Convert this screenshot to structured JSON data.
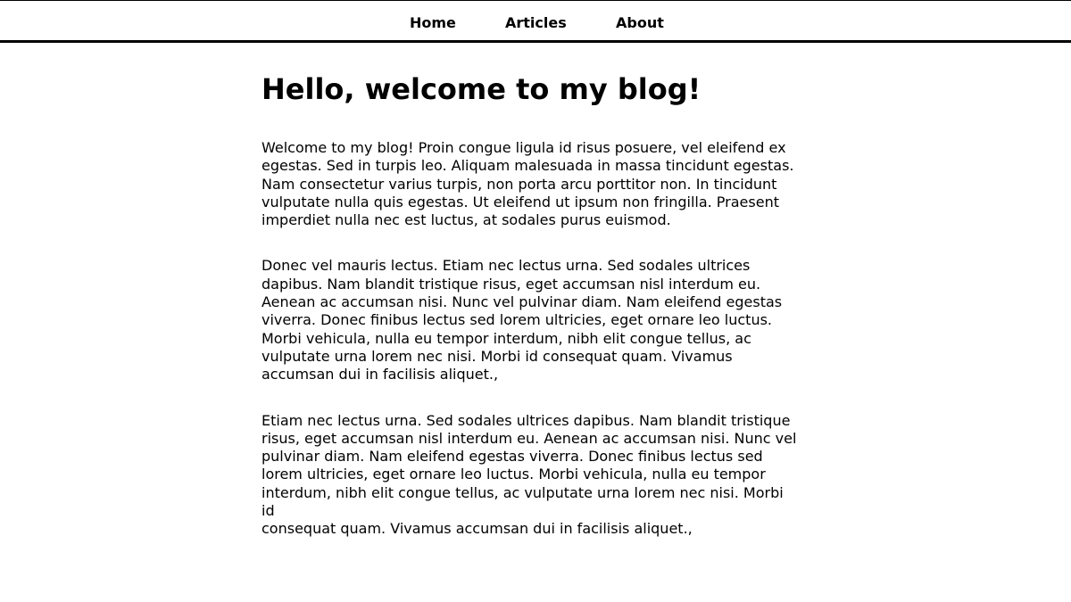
{
  "nav": {
    "items": [
      {
        "label": "Home"
      },
      {
        "label": "Articles"
      },
      {
        "label": "About"
      }
    ]
  },
  "main": {
    "title": "Hello, welcome to my blog!",
    "paragraphs": [
      "Welcome to my blog! Proin congue ligula id risus posuere, vel eleifend ex\negestas. Sed in turpis leo. Aliquam malesuada in massa tincidunt egestas.\nNam consectetur varius turpis, non porta arcu porttitor non. In tincidunt\nvulputate nulla quis egestas. Ut eleifend ut ipsum non fringilla. Praesent\nimperdiet nulla nec est luctus, at sodales purus euismod.",
      "Donec vel mauris lectus. Etiam nec lectus urna. Sed sodales ultrices\ndapibus. Nam blandit tristique risus, eget accumsan nisl interdum eu.\nAenean ac accumsan nisi. Nunc vel pulvinar diam. Nam eleifend egestas\nviverra. Donec finibus lectus sed lorem ultricies, eget ornare leo luctus.\nMorbi vehicula, nulla eu tempor interdum, nibh elit congue tellus, ac\nvulputate urna lorem nec nisi. Morbi id consequat quam. Vivamus\naccumsan dui in facilisis aliquet.,",
      "Etiam nec lectus urna. Sed sodales ultrices dapibus. Nam blandit tristique\nrisus, eget accumsan nisl interdum eu. Aenean ac accumsan nisi. Nunc vel\npulvinar diam. Nam eleifend egestas viverra. Donec finibus lectus sed\nlorem ultricies, eget ornare leo luctus. Morbi vehicula, nulla eu tempor\ninterdum, nibh elit congue tellus, ac vulputate urna lorem nec nisi. Morbi id\nconsequat quam. Vivamus accumsan dui in facilisis aliquet.,"
    ]
  }
}
